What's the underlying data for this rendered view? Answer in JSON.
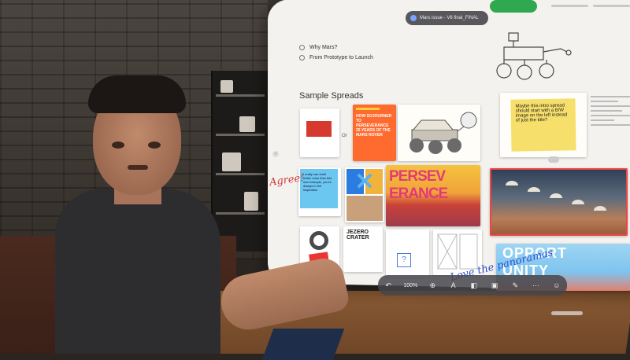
{
  "window": {
    "document_title": "Mars issue - V6 final_FINAL",
    "share_label": "",
    "outline": [
      "Why Mars?",
      "From Prototype to Launch"
    ],
    "section_title": "Sample Spreads",
    "or_label": "Or"
  },
  "spreads": {
    "orange_headline": "HOW SOJOURNER TO PERSEVERANCE 25 YEARS OF THE MARS ROVER",
    "sticky_note": "Maybe this intro spread should start with a B/W image on the left instead of just the title?",
    "blue_note": "I really can build better ones than this one example, you're always in the inspiration",
    "persev_line1": "PERSEV",
    "persev_line2": "ERANCE",
    "jezero_title": "JEZERO CRATER",
    "question_mark": "?",
    "opportunity_line1": "OPPORT",
    "opportunity_line2": "UNITY"
  },
  "annotations": {
    "agree": "Agree!",
    "love": "Love the panoramas"
  },
  "toolbar": {
    "zoom": "100%"
  },
  "icons": {
    "undo": "undo-icon",
    "zoom": "zoom-icon",
    "insert": "insert-icon",
    "text": "text-icon",
    "shapes": "shapes-icon",
    "media": "media-icon",
    "pen": "pen-icon",
    "more": "more-icon",
    "collab": "collaborate-icon"
  },
  "colors": {
    "accent_green": "#2fa84f",
    "selection_red": "#e44444",
    "ink_blue": "#2a4fd0"
  }
}
